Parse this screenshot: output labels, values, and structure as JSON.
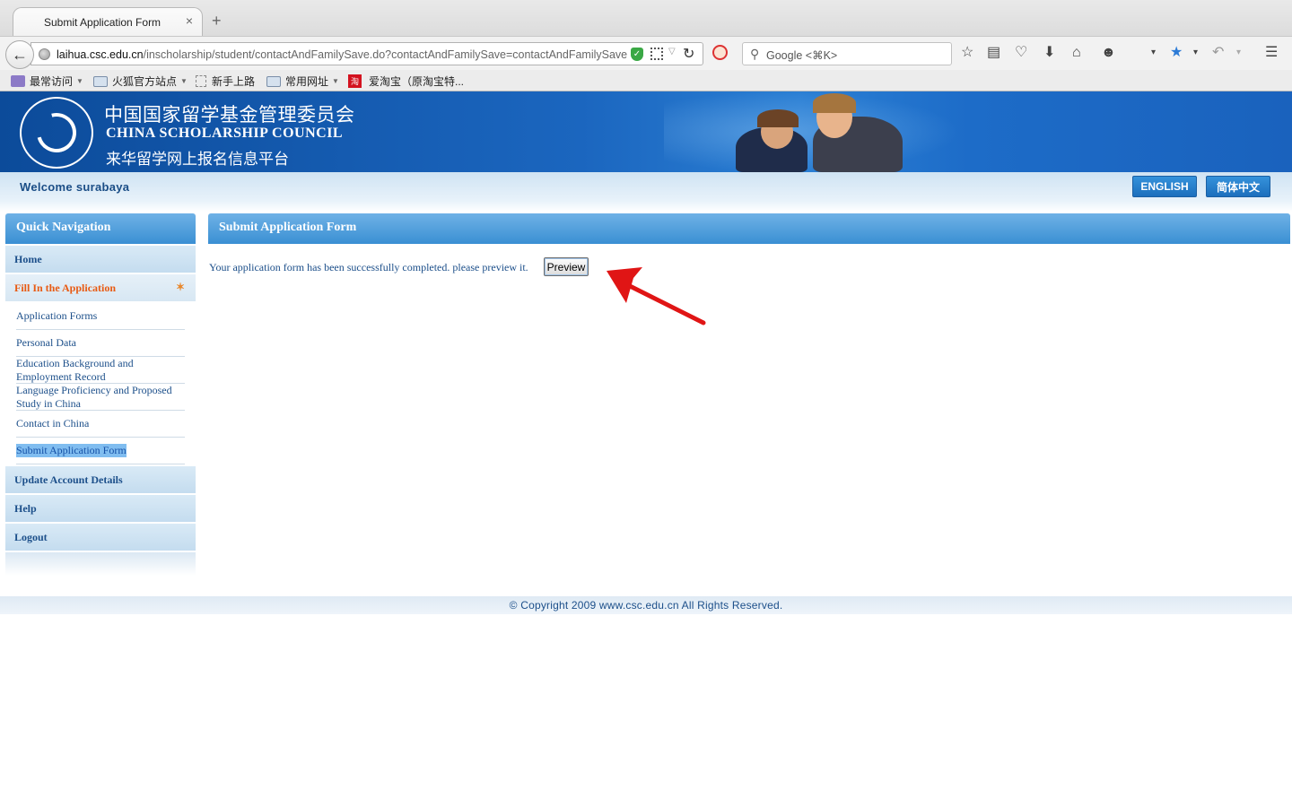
{
  "browser": {
    "tab_title": "Submit Application Form",
    "tab_close": "×",
    "new_tab": "+",
    "url_domain": "laihua.csc.edu.cn",
    "url_path": "/inscholarship/student/contactAndFamilySave.do?contactAndFamilySave=contactAndFamilySave",
    "search_placeholder": "Google <⌘K>",
    "bookmarks": [
      {
        "label": "最常访问"
      },
      {
        "label": "火狐官方站点"
      },
      {
        "label": "新手上路"
      },
      {
        "label": "常用网址"
      },
      {
        "label": "爱淘宝（原淘宝特..."
      }
    ]
  },
  "banner": {
    "title_cn": "中国国家留学基金管理委员会",
    "title_en": "CHINA SCHOLARSHIP COUNCIL",
    "subtitle_cn": "来华留学网上报名信息平台"
  },
  "welcome": {
    "text": "Welcome surabaya",
    "lang_english": "ENGLISH",
    "lang_chinese": "简体中文"
  },
  "sidebar": {
    "title": "Quick Navigation",
    "home": "Home",
    "fill_in": "Fill In the Application",
    "sub_items": [
      "Application Forms",
      "Personal Data",
      "Education Background and Employment Record",
      "Language Proficiency and Proposed Study in China",
      "Contact in China",
      "Submit Application Form"
    ],
    "update_account": "Update Account Details",
    "help": "Help",
    "logout": "Logout"
  },
  "main": {
    "title": "Submit Application Form",
    "message": "Your application form has been successfully completed. please preview it.",
    "preview_label": "Preview"
  },
  "footer": {
    "copyright": "© Copyright 2009 www.csc.edu.cn All Rights Reserved."
  },
  "colors": {
    "accent_blue": "#3a8fd3",
    "active_orange": "#e85a12",
    "annotation_red": "#e01515"
  }
}
